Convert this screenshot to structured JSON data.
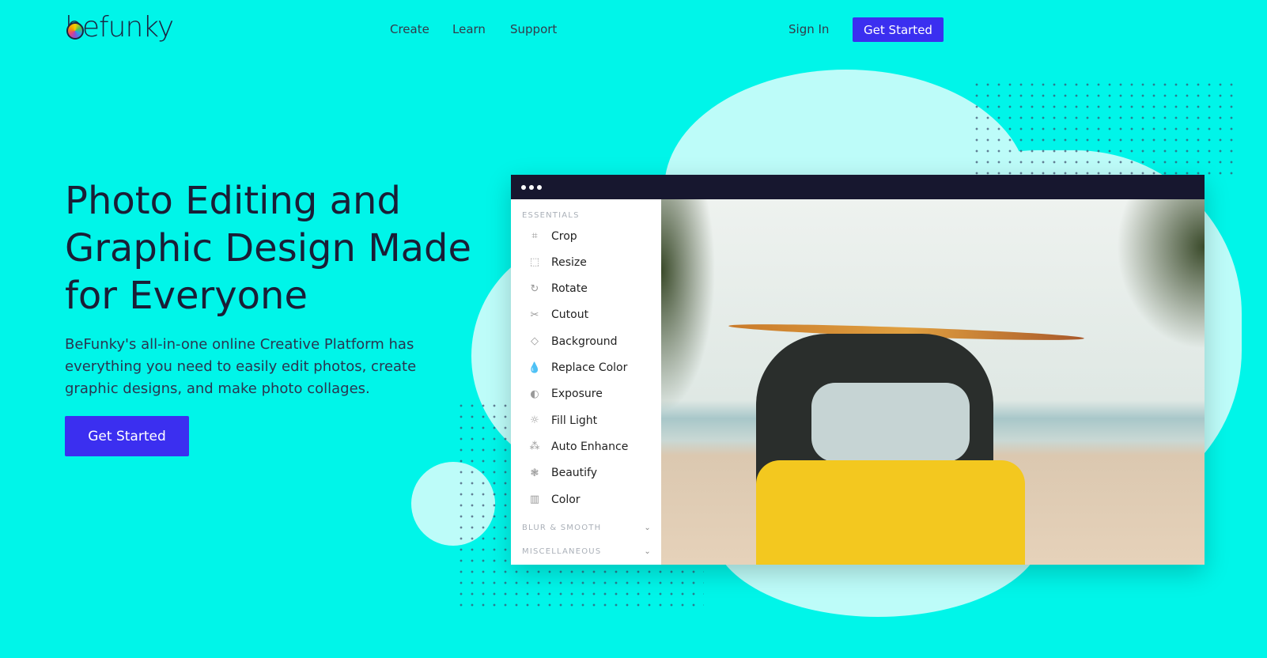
{
  "brand": {
    "name": "befunky"
  },
  "nav": {
    "links": [
      "Create",
      "Learn",
      "Support"
    ],
    "sign_in": "Sign In",
    "get_started": "Get Started"
  },
  "hero": {
    "title": "Photo Editing and Graphic Design Made for Everyone",
    "subtitle": "BeFunky's all-in-one online Creative Platform has everything you need to easily edit photos, create graphic designs, and make photo collages.",
    "cta": "Get Started"
  },
  "editor": {
    "section_essentials": "ESSENTIALS",
    "items": [
      {
        "label": "Crop",
        "icon": "crop-icon"
      },
      {
        "label": "Resize",
        "icon": "resize-icon"
      },
      {
        "label": "Rotate",
        "icon": "rotate-icon"
      },
      {
        "label": "Cutout",
        "icon": "scissors-icon"
      },
      {
        "label": "Background",
        "icon": "diamond-icon"
      },
      {
        "label": "Replace Color",
        "icon": "droplets-icon"
      },
      {
        "label": "Exposure",
        "icon": "exposure-icon"
      },
      {
        "label": "Fill Light",
        "icon": "sun-icon"
      },
      {
        "label": "Auto Enhance",
        "icon": "wand-icon"
      },
      {
        "label": "Beautify",
        "icon": "flower-icon"
      },
      {
        "label": "Color",
        "icon": "palette-icon"
      }
    ],
    "section_blur": "BLUR & SMOOTH",
    "section_misc": "MISCELLANEOUS"
  },
  "colors": {
    "background": "#00f5e9",
    "accent": "#3b2ff0",
    "blob": "#bdfcf9",
    "editor_bar": "#17172f"
  }
}
